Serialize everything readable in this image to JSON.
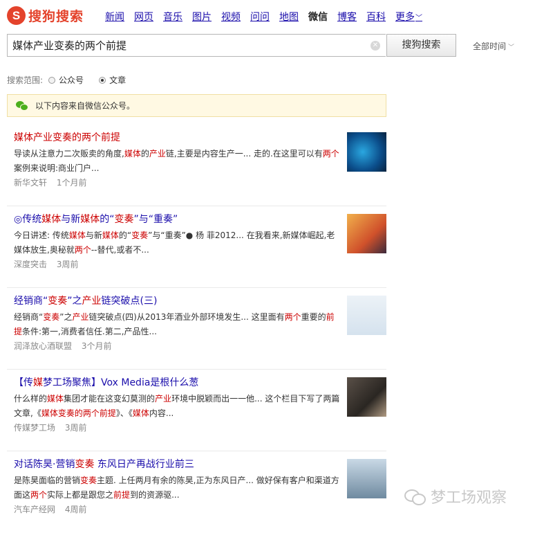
{
  "brand": {
    "logo_mark": "S",
    "logo_text": "搜狗搜索",
    "accent": "#e4432c"
  },
  "nav": [
    {
      "label": "新闻",
      "active": false
    },
    {
      "label": "网页",
      "active": false
    },
    {
      "label": "音乐",
      "active": false
    },
    {
      "label": "图片",
      "active": false
    },
    {
      "label": "视频",
      "active": false
    },
    {
      "label": "问问",
      "active": false
    },
    {
      "label": "地图",
      "active": false
    },
    {
      "label": "微信",
      "active": true
    },
    {
      "label": "博客",
      "active": false
    },
    {
      "label": "百科",
      "active": false
    },
    {
      "label": "更多",
      "active": false
    }
  ],
  "search": {
    "query": "媒体产业变奏的两个前提",
    "button_label": "搜狗搜索",
    "clear_icon": "close-icon"
  },
  "time_filter": {
    "label": "全部时间",
    "icon": "chevron-down-icon"
  },
  "scope": {
    "label": "搜索范围:",
    "options": [
      {
        "label": "公众号",
        "selected": false
      },
      {
        "label": "文章",
        "selected": true
      }
    ]
  },
  "notice": {
    "text": "以下内容来自微信公众号。",
    "icon": "wechat-icon",
    "color": "#4caf1c"
  },
  "results": [
    {
      "title": [
        [
          "媒体产业变奏的两个前提",
          true
        ]
      ],
      "snippet": [
        [
          "导读从注意力二次贩卖的角度,",
          false
        ],
        [
          "媒体",
          true
        ],
        [
          "的",
          false
        ],
        [
          "产业",
          true
        ],
        [
          "链,主要是内容生产一... 走的.在这里可以有",
          false
        ],
        [
          "两个",
          true
        ],
        [
          "案例来说明:商业门户...",
          false
        ]
      ],
      "source": "新华文轩",
      "time": "1个月前"
    },
    {
      "title": [
        [
          "◎传统",
          false
        ],
        [
          "媒体",
          true
        ],
        [
          "与新",
          false
        ],
        [
          "媒体",
          true
        ],
        [
          "的“",
          false
        ],
        [
          "变奏",
          true
        ],
        [
          "”与“重奏”",
          false
        ]
      ],
      "snippet": [
        [
          "今日讲述: 传统",
          false
        ],
        [
          "媒体",
          true
        ],
        [
          "与新",
          false
        ],
        [
          "媒体",
          true
        ],
        [
          "的“",
          false
        ],
        [
          "变奏",
          true
        ],
        [
          "”与“重奏”● 杨  菲2012... 在我看来,新媒体崛起,老媒体放生,奥秘就",
          false
        ],
        [
          "两个",
          true
        ],
        [
          "--替代,或者不...",
          false
        ]
      ],
      "source": "深度突击",
      "time": "3周前"
    },
    {
      "title": [
        [
          "经销商“",
          false
        ],
        [
          "变奏",
          true
        ],
        [
          "”之",
          false
        ],
        [
          "产业",
          true
        ],
        [
          "链突破点(三)",
          false
        ]
      ],
      "snippet": [
        [
          "经销商“",
          false
        ],
        [
          "变奏",
          true
        ],
        [
          "”之",
          false
        ],
        [
          "产业",
          true
        ],
        [
          "链突破点(四)从2013年酒业外部环境发生... 这里面有",
          false
        ],
        [
          "两个",
          true
        ],
        [
          "重要的",
          false
        ],
        [
          "前提",
          true
        ],
        [
          "条件:第一,消费者信任.第二,产品性...",
          false
        ]
      ],
      "source": "润泽放心酒联盟",
      "time": "3个月前"
    },
    {
      "title": [
        [
          "【传",
          false
        ],
        [
          "媒",
          true
        ],
        [
          "梦工场聚焦】Vox Media是根什么葱",
          false
        ]
      ],
      "snippet": [
        [
          "什么样的",
          false
        ],
        [
          "媒体",
          true
        ],
        [
          "集团才能在这变幻莫测的",
          false
        ],
        [
          "产业",
          true
        ],
        [
          "环境中脱颖而出一一他... 这个栏目下写了两篇文章,《",
          false
        ],
        [
          "媒体变奏的两个前提",
          true
        ],
        [
          "》、《",
          false
        ],
        [
          "媒体",
          true
        ],
        [
          "内容...",
          false
        ]
      ],
      "source": "传媒梦工场",
      "time": "3周前"
    },
    {
      "title": [
        [
          "对话陈昊·营销",
          false
        ],
        [
          "变奏",
          true
        ],
        [
          "  东风日产再战行业前三",
          false
        ]
      ],
      "snippet": [
        [
          "是陈昊面临的营销",
          false
        ],
        [
          "变奏",
          true
        ],
        [
          "主题. 上任两月有余的陈昊,正为东风日产... 做好保有客户和渠道方面这",
          false
        ],
        [
          "两个",
          true
        ],
        [
          "实际上都是跟您之",
          false
        ],
        [
          "前提",
          true
        ],
        [
          "到的资源驱...",
          false
        ]
      ],
      "source": "汽车产经网",
      "time": "4周前"
    }
  ],
  "watermark": {
    "text": "梦工场观察",
    "icon": "wechat-icon"
  }
}
